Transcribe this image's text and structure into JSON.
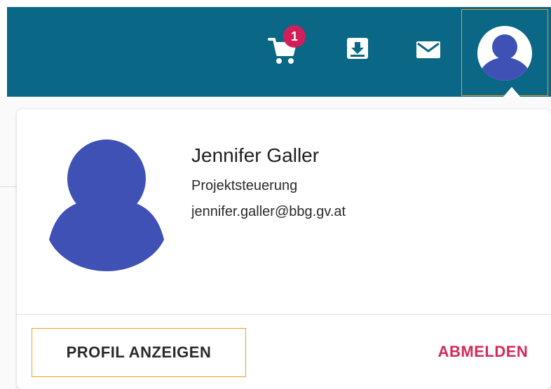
{
  "header": {
    "cart_badge_count": "1",
    "icons": [
      "cart-icon",
      "download-icon",
      "mail-icon",
      "user-avatar-icon"
    ],
    "colors": {
      "topbar": "#0a6785",
      "badge": "#d21f5a",
      "focus_outline": "#f29b1d",
      "avatar": "#3f51b5"
    }
  },
  "user_menu": {
    "name": "Jennifer Galler",
    "role": "Projektsteuerung",
    "email": "jennifer.galler@bbg.gv.at",
    "actions": {
      "view_profile": "PROFIL ANZEIGEN",
      "logout": "ABMELDEN"
    },
    "colors": {
      "logout": "#d22a58"
    }
  }
}
